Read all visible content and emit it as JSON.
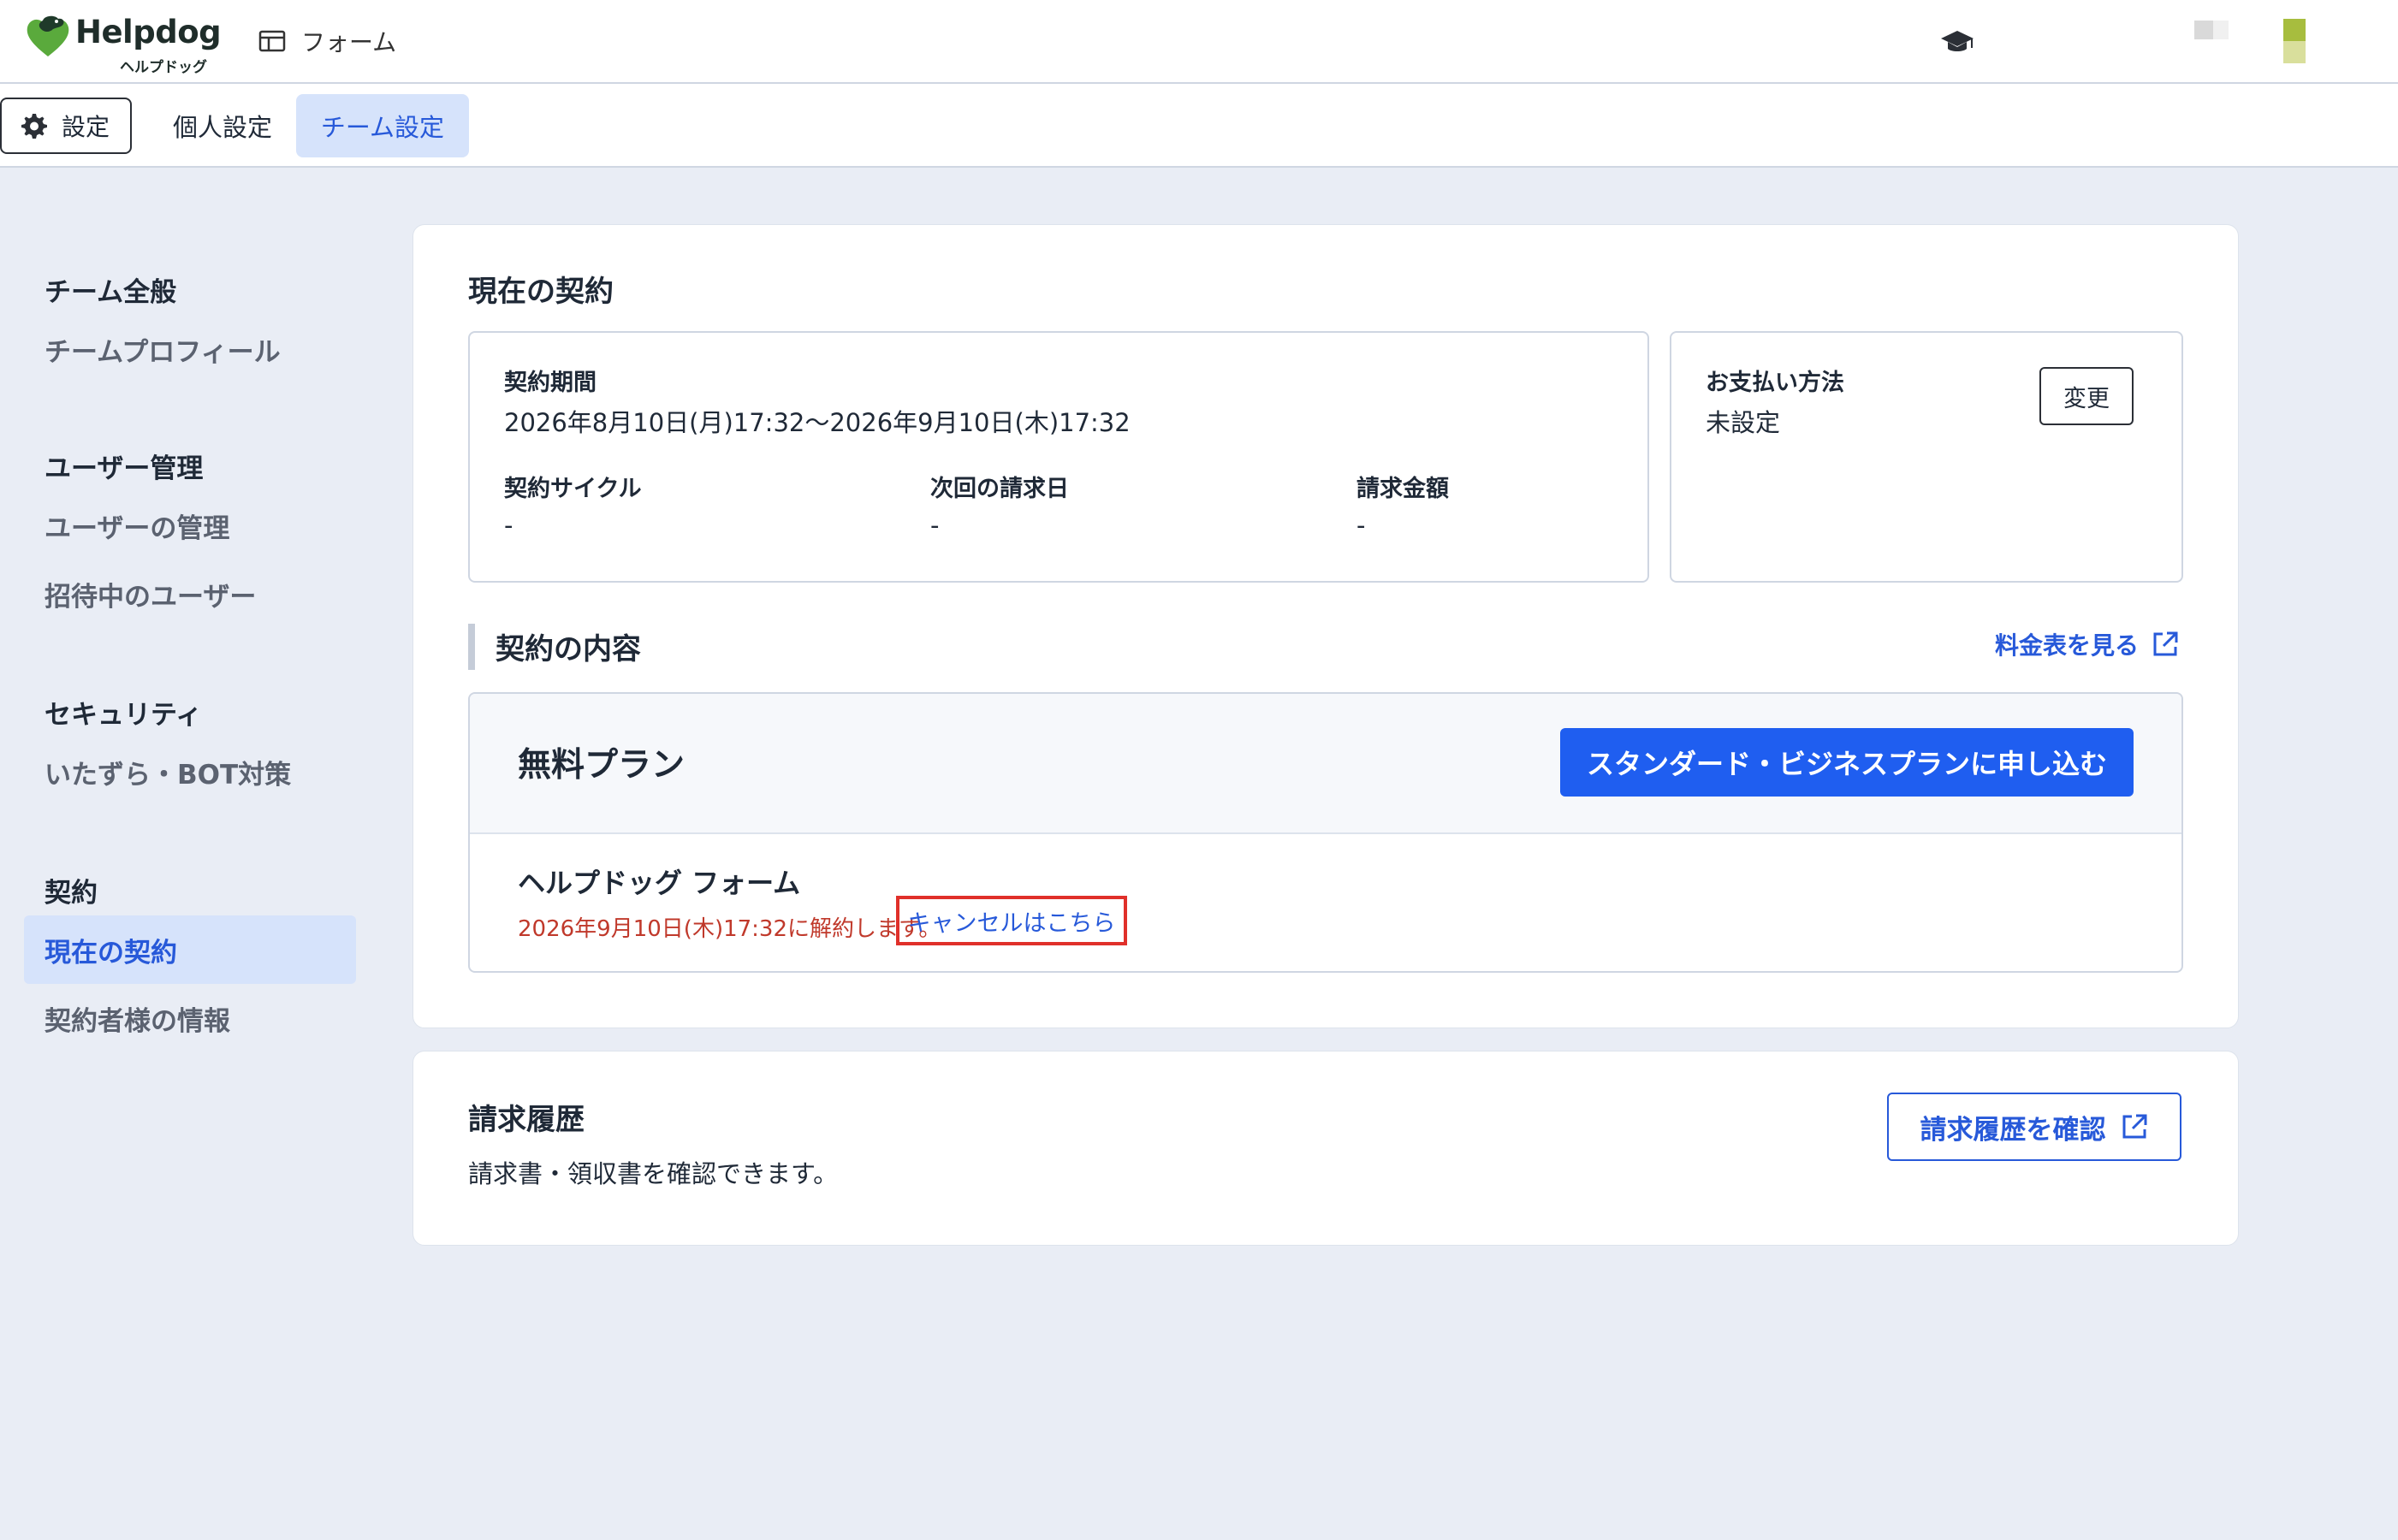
{
  "header": {
    "brand_name": "Helpdog",
    "brand_kana": "ヘルプドッグ",
    "app_label": "フォーム",
    "brand_color": "#4a9a3a"
  },
  "tabs": {
    "settings_label": "設定",
    "personal_label": "個人設定",
    "team_label": "チーム設定",
    "active": "チーム設定"
  },
  "sidebar": {
    "groups": [
      {
        "heading": "チーム全般",
        "items": [
          "チームプロフィール"
        ]
      },
      {
        "heading": "ユーザー管理",
        "items": [
          "ユーザーの管理",
          "招待中のユーザー"
        ]
      },
      {
        "heading": "セキュリティ",
        "items": [
          "いたずら・BOT対策"
        ]
      },
      {
        "heading": "契約",
        "items": [
          "現在の契約",
          "契約者様の情報"
        ]
      }
    ],
    "active_item": "現在の契約"
  },
  "contract": {
    "title": "現在の契約",
    "period_label": "契約期間",
    "period_value": "2026年8月10日(月)17:32〜2026年9月10日(木)17:32",
    "cycle_label": "契約サイクル",
    "cycle_value": "-",
    "next_billing_label": "次回の請求日",
    "next_billing_value": "-",
    "amount_label": "請求金額",
    "amount_value": "-",
    "payment_label": "お支払い方法",
    "payment_value": "未設定",
    "change_button": "変更"
  },
  "plan": {
    "section_title": "契約の内容",
    "pricing_link": "料金表を見る",
    "plan_name": "無料プラン",
    "apply_button": "スタンダード・ビジネスプランに申し込む",
    "product_name": "ヘルプドッグ フォーム",
    "cancel_message": "2026年9月10日(木)17:32に解約します。",
    "cancel_link": "キャンセルはこちら"
  },
  "billing": {
    "title": "請求履歴",
    "description": "請求書・領収書を確認できます。",
    "button": "請求履歴を確認"
  },
  "colors": {
    "accent": "#2759d9",
    "primary_button": "#1f5ef0",
    "warning_text": "#c0392b",
    "highlight_border": "#e0302a",
    "page_background": "#e9edf5"
  }
}
